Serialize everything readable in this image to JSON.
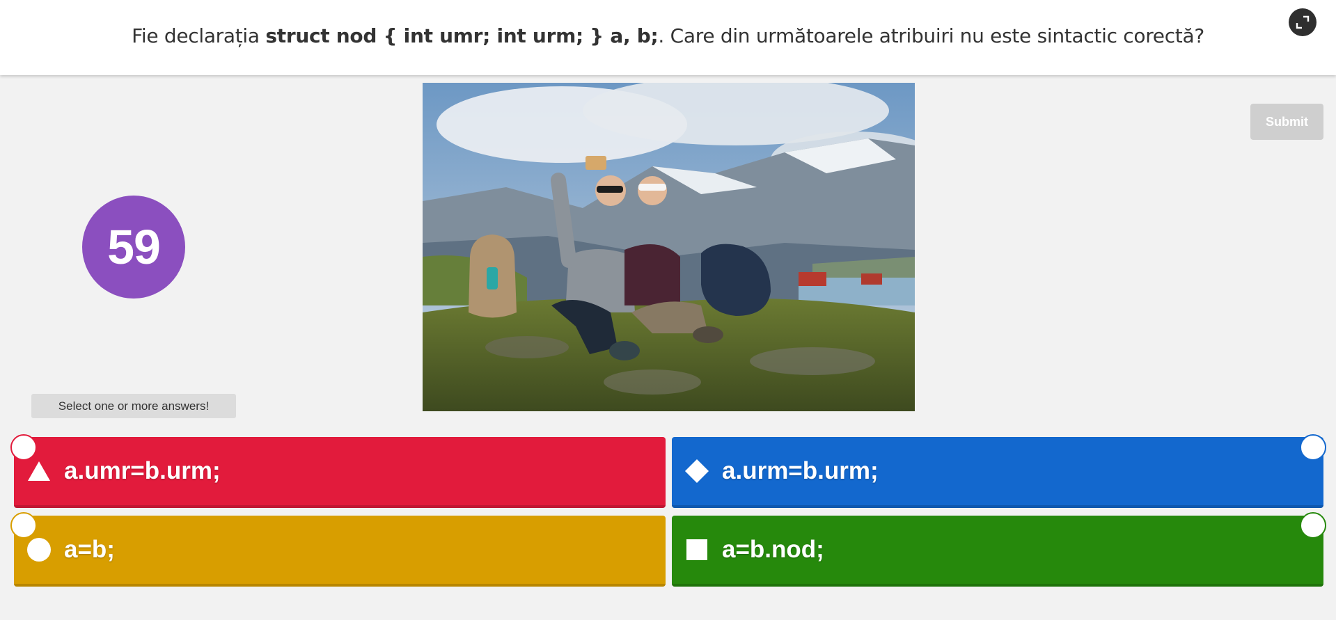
{
  "question": {
    "prefix": "Fie declarația ",
    "code": "struct nod { int umr; int urm; } a, b;",
    "suffix": ". Care din următoarele atribuiri nu este sintactic corectă?"
  },
  "controls": {
    "submit_label": "Submit",
    "fullscreen_icon": "expand-icon"
  },
  "timer": {
    "seconds": "59",
    "color": "#8b4fbf"
  },
  "hint": "Select one or more answers!",
  "answers": [
    {
      "label": "a.umr=b.urm;",
      "shape": "triangle",
      "color": "#e21b3c"
    },
    {
      "label": "a.urm=b.urm;",
      "shape": "diamond",
      "color": "#1368ce"
    },
    {
      "label": "a=b;",
      "shape": "circle",
      "color": "#d89e00"
    },
    {
      "label": "a=b.nod;",
      "shape": "square",
      "color": "#26890c"
    }
  ]
}
